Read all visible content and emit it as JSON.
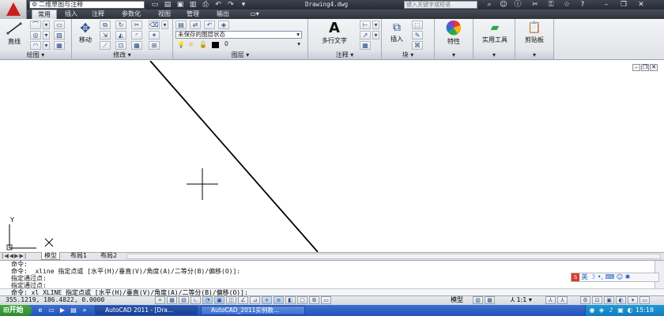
{
  "titlebar": {
    "workspace": "二维草图与注释",
    "doc_title": "Drawing4.dwg",
    "search_placeholder": "键入关键字或短语"
  },
  "tabs": [
    "常用",
    "插入",
    "注释",
    "参数化",
    "视图",
    "管理",
    "输出"
  ],
  "ribbon": {
    "draw": {
      "line_label": "直线",
      "panel_label": "绘图"
    },
    "modify": {
      "move_label": "移动",
      "panel_label": "修改"
    },
    "layers": {
      "layer_state": "未保存的图层状态",
      "layer_name": "0",
      "panel_label": "图层"
    },
    "annotation": {
      "mtext_label": "多行文字",
      "panel_label": "注释"
    },
    "block": {
      "insert_label": "插入",
      "panel_label": "块"
    },
    "properties": {
      "label": "特性"
    },
    "utilities": {
      "label": "实用工具"
    },
    "clipboard": {
      "label": "剪贴板"
    }
  },
  "layout_tabs": [
    "模型",
    "布局1",
    "布局2"
  ],
  "command": {
    "lines": [
      "命令:",
      "命令: _xline 指定点或 [水平(H)/垂直(V)/角度(A)/二等分(B)/偏移(O)]:",
      "指定通过点:",
      "指定通过点:",
      "命令: xl XLINE 指定点或 [水平(H)/垂直(V)/角度(A)/二等分(B)/偏移(O)]:"
    ]
  },
  "ime": {
    "lang": "英"
  },
  "status": {
    "coords": "355.1219, 186.4822, 0.0000",
    "model": "模型",
    "scale": "1:1"
  },
  "taskbar": {
    "start": "开始",
    "tasks": [
      "AutoCAD 2011 - [Dra...",
      "AutoCAD_2011实例教..."
    ],
    "clock": "15:18"
  },
  "ucs": {
    "x": "X",
    "y": "Y"
  }
}
